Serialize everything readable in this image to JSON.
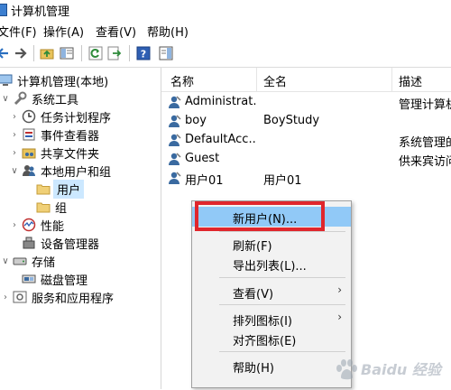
{
  "window": {
    "title": "计算机管理"
  },
  "menu": [
    "文件(F)",
    "操作(A)",
    "查看(V)",
    "帮助(H)"
  ],
  "toolbar": {
    "icons": [
      "back-arrow-icon",
      "forward-arrow-icon",
      "up-folder-icon",
      "show-hide-tree-icon",
      "refresh-icon",
      "export-icon",
      "help-icon",
      "action-pane-icon"
    ]
  },
  "tree": {
    "root": "计算机管理(本地)",
    "system_tools": "系统工具",
    "task_scheduler": "任务计划程序",
    "event_viewer": "事件查看器",
    "shared_folders": "共享文件夹",
    "local_users_groups": "本地用户和组",
    "users": "用户",
    "groups": "组",
    "performance": "性能",
    "device_manager": "设备管理器",
    "storage": "存储",
    "disk_management": "磁盘管理",
    "services_apps": "服务和应用程序"
  },
  "list": {
    "columns": [
      "名称",
      "全名",
      "描述"
    ],
    "rows": [
      {
        "name": "Administrat...",
        "fullname": "",
        "desc": "管理计算机"
      },
      {
        "name": "boy",
        "fullname": "BoyStudy",
        "desc": ""
      },
      {
        "name": "DefaultAcc...",
        "fullname": "",
        "desc": "系统管理的"
      },
      {
        "name": "Guest",
        "fullname": "",
        "desc": "供来宾访问"
      },
      {
        "name": "用户01",
        "fullname": "用户01",
        "desc": ""
      }
    ]
  },
  "context_menu": {
    "new_user": "新用户(N)...",
    "refresh": "刷新(F)",
    "export": "导出列表(L)...",
    "view": "查看(V)",
    "arrange": "排列图标(I)",
    "align": "对齐图标(E)",
    "help": "帮助(H)"
  },
  "colors": {
    "highlight_box": "#e0262c",
    "menu_hover": "#91c9f7",
    "tree_selected": "#cce8ff"
  },
  "watermark": "Baidu 经验"
}
